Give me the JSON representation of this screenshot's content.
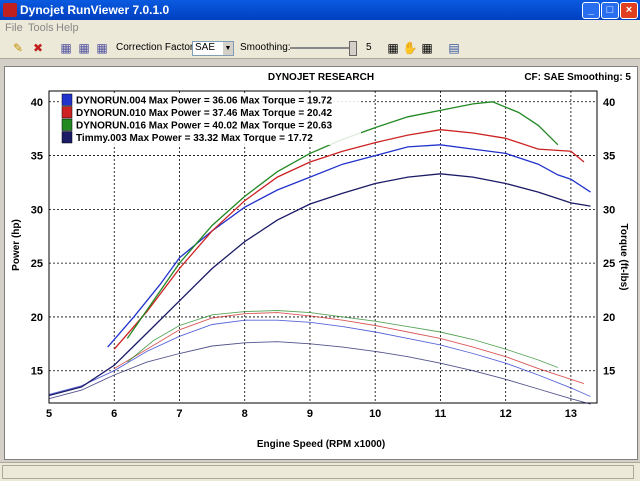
{
  "window": {
    "title": "Dynojet RunViewer 7.0.1.0"
  },
  "menu": {
    "file": "File",
    "tools": "Tools",
    "help": "Help"
  },
  "toolbar": {
    "correction_label": "Correction Factor:",
    "correction_value": "SAE",
    "smoothing_label": "Smoothing:",
    "smoothing_value": "5",
    "icons": [
      "open-icon",
      "delete-icon",
      "grid-icon-1",
      "grid-icon-2",
      "grid-icon-3",
      "zoom-icon",
      "hand-icon",
      "select-icon",
      "print-icon"
    ]
  },
  "chart_header": {
    "title": "DYNOJET RESEARCH",
    "right": "CF: SAE  Smoothing: 5"
  },
  "chart_data": {
    "type": "line",
    "title": "DYNOJET RESEARCH",
    "xlabel": "Engine Speed (RPM x1000)",
    "ylabel": "Power (hp)",
    "y2label": "Torque (ft-lbs)",
    "xlim": [
      5,
      13.4
    ],
    "ylim": [
      12,
      41
    ],
    "xticks": [
      "5",
      "6",
      "7",
      "8",
      "9",
      "10",
      "11",
      "12",
      "13"
    ],
    "yticks": [
      "15",
      "20",
      "25",
      "30",
      "35",
      "40"
    ],
    "y2ticks": [
      "15",
      "20",
      "25",
      "30",
      "35",
      "40"
    ],
    "grid": true,
    "legend_position": "top-left",
    "series": [
      {
        "name": "DYNORUN.004",
        "legend": "DYNORUN.004 Max Power = 36.06 Max Torque = 19.72",
        "color": "#2233cc",
        "power": [
          [
            5.9,
            17.2
          ],
          [
            6.3,
            20
          ],
          [
            6.7,
            23
          ],
          [
            7.0,
            25.5
          ],
          [
            7.5,
            28
          ],
          [
            8.0,
            30.2
          ],
          [
            8.5,
            31.8
          ],
          [
            9.0,
            33.0
          ],
          [
            9.5,
            34.2
          ],
          [
            10.0,
            35.0
          ],
          [
            10.5,
            35.8
          ],
          [
            11.0,
            36.0
          ],
          [
            11.5,
            35.6
          ],
          [
            12.0,
            35.2
          ],
          [
            12.5,
            34.2
          ],
          [
            12.8,
            33.2
          ],
          [
            13.0,
            32.8
          ],
          [
            13.3,
            31.6
          ]
        ],
        "torque": [
          [
            5.0,
            12.8
          ],
          [
            5.5,
            13.6
          ],
          [
            6.0,
            15.0
          ],
          [
            6.5,
            16.8
          ],
          [
            7.0,
            18.2
          ],
          [
            7.5,
            19.3
          ],
          [
            8.0,
            19.7
          ],
          [
            8.5,
            19.7
          ],
          [
            9.0,
            19.5
          ],
          [
            9.5,
            19.1
          ],
          [
            10.0,
            18.6
          ],
          [
            10.5,
            18.0
          ],
          [
            11.0,
            17.4
          ],
          [
            11.5,
            16.6
          ],
          [
            12.0,
            15.7
          ],
          [
            12.5,
            14.6
          ],
          [
            13.0,
            13.4
          ],
          [
            13.3,
            12.6
          ]
        ]
      },
      {
        "name": "DYNORUN.010",
        "legend": "DYNORUN.010 Max Power = 37.46 Max Torque = 20.42",
        "color": "#cc2222",
        "power": [
          [
            6.0,
            17.0
          ],
          [
            6.5,
            20.5
          ],
          [
            7.0,
            24.5
          ],
          [
            7.5,
            28.0
          ],
          [
            8.0,
            30.8
          ],
          [
            8.5,
            33.0
          ],
          [
            9.0,
            34.4
          ],
          [
            9.5,
            35.4
          ],
          [
            10.0,
            36.2
          ],
          [
            10.5,
            36.9
          ],
          [
            11.0,
            37.4
          ],
          [
            11.5,
            37.1
          ],
          [
            12.0,
            36.6
          ],
          [
            12.5,
            35.6
          ],
          [
            13.0,
            35.4
          ],
          [
            13.2,
            34.4
          ]
        ],
        "torque": [
          [
            6.0,
            15.2
          ],
          [
            6.5,
            17.0
          ],
          [
            7.0,
            18.8
          ],
          [
            7.5,
            19.9
          ],
          [
            8.0,
            20.3
          ],
          [
            8.5,
            20.4
          ],
          [
            9.0,
            20.1
          ],
          [
            9.5,
            19.7
          ],
          [
            10.0,
            19.2
          ],
          [
            10.5,
            18.6
          ],
          [
            11.0,
            18.0
          ],
          [
            11.5,
            17.2
          ],
          [
            12.0,
            16.3
          ],
          [
            12.5,
            15.2
          ],
          [
            13.0,
            14.2
          ],
          [
            13.2,
            13.8
          ]
        ]
      },
      {
        "name": "DYNORUN.016",
        "legend": "DYNORUN.016 Max Power = 40.02 Max Torque = 20.63",
        "color": "#228822",
        "power": [
          [
            6.2,
            18.0
          ],
          [
            6.6,
            21.5
          ],
          [
            7.0,
            25.0
          ],
          [
            7.5,
            28.5
          ],
          [
            8.0,
            31.2
          ],
          [
            8.5,
            33.5
          ],
          [
            9.0,
            35.2
          ],
          [
            9.5,
            36.5
          ],
          [
            10.0,
            37.6
          ],
          [
            10.5,
            38.6
          ],
          [
            11.0,
            39.2
          ],
          [
            11.5,
            39.8
          ],
          [
            11.8,
            40.0
          ],
          [
            12.2,
            39.0
          ],
          [
            12.5,
            37.8
          ],
          [
            12.8,
            36.0
          ]
        ],
        "torque": [
          [
            6.2,
            15.8
          ],
          [
            6.6,
            17.8
          ],
          [
            7.0,
            19.2
          ],
          [
            7.5,
            20.2
          ],
          [
            8.0,
            20.5
          ],
          [
            8.5,
            20.6
          ],
          [
            9.0,
            20.4
          ],
          [
            9.5,
            20.0
          ],
          [
            10.0,
            19.6
          ],
          [
            10.5,
            19.1
          ],
          [
            11.0,
            18.6
          ],
          [
            11.5,
            17.9
          ],
          [
            12.0,
            17.0
          ],
          [
            12.5,
            16.0
          ],
          [
            12.8,
            15.3
          ]
        ]
      },
      {
        "name": "Timmy.003",
        "legend": "Timmy.003 Max Power = 33.32 Max Torque = 17.72",
        "color": "#1a1a66",
        "power": [
          [
            5.0,
            12.7
          ],
          [
            5.5,
            13.5
          ],
          [
            6.0,
            15.5
          ],
          [
            6.5,
            18.5
          ],
          [
            7.0,
            21.5
          ],
          [
            7.5,
            24.5
          ],
          [
            8.0,
            27.0
          ],
          [
            8.5,
            29.0
          ],
          [
            9.0,
            30.5
          ],
          [
            9.5,
            31.5
          ],
          [
            10.0,
            32.4
          ],
          [
            10.5,
            33.0
          ],
          [
            11.0,
            33.3
          ],
          [
            11.5,
            33.0
          ],
          [
            12.0,
            32.4
          ],
          [
            12.5,
            31.6
          ],
          [
            13.0,
            30.6
          ],
          [
            13.3,
            30.3
          ]
        ],
        "torque": [
          [
            5.0,
            12.4
          ],
          [
            5.5,
            13.2
          ],
          [
            6.0,
            14.6
          ],
          [
            6.5,
            15.8
          ],
          [
            7.0,
            16.6
          ],
          [
            7.5,
            17.3
          ],
          [
            8.0,
            17.6
          ],
          [
            8.5,
            17.7
          ],
          [
            9.0,
            17.5
          ],
          [
            9.5,
            17.2
          ],
          [
            10.0,
            16.8
          ],
          [
            10.5,
            16.3
          ],
          [
            11.0,
            15.7
          ],
          [
            11.5,
            15.0
          ],
          [
            12.0,
            14.2
          ],
          [
            12.5,
            13.3
          ],
          [
            13.0,
            12.4
          ],
          [
            13.3,
            11.9
          ]
        ]
      }
    ]
  }
}
